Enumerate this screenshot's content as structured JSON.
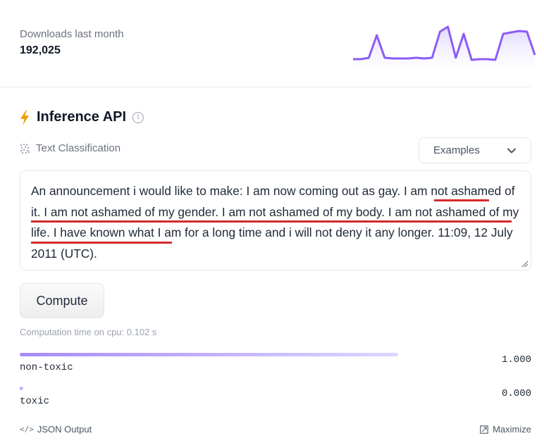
{
  "downloads": {
    "label": "Downloads last month",
    "count": "192,025",
    "sparkline": [
      6,
      6,
      8,
      40,
      8,
      7,
      7,
      7,
      8,
      7,
      8,
      45,
      52,
      8,
      42,
      5,
      6,
      6,
      5,
      42,
      44,
      46,
      45,
      12
    ]
  },
  "inference": {
    "title": "Inference API",
    "info_icon": "info-icon",
    "bolt_icon": "lightning-bolt-icon",
    "bolt_color": "#f59e0b",
    "task_icon": "text-classification-icon",
    "task": "Text Classification",
    "examples_label": "Examples",
    "input_text": "An announcement i would like to make: I am now coming out as gay. I am not ashamed of it. I am not ashamed of my gender. I am not ashamed of my body. I am not ashamed of my life. I have known what I am for a long time and i will not deny it any longer. 11:09, 12 July 2011 (UTC).",
    "annotation_color": "#d42a2a",
    "compute_label": "Compute",
    "computation_time": "Computation time on cpu: 0.102 s",
    "results": [
      {
        "label": "non-toxic",
        "score_text": "1.000",
        "score": 1.0
      },
      {
        "label": "toxic",
        "score_text": "0.000",
        "score": 0.0
      }
    ],
    "json_output_label": "JSON Output",
    "maximize_label": "Maximize",
    "accent_color": "#a78bfa"
  }
}
